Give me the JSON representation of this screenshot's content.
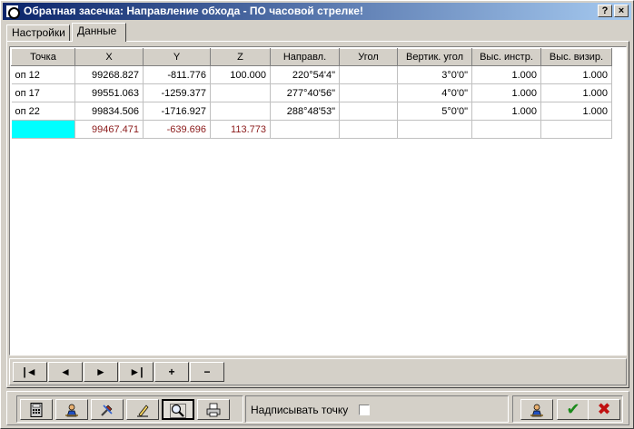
{
  "window": {
    "title": "Обратная засечка:  Направление обхода - ПО часовой стрелке!",
    "help_label": "?",
    "close_label": "×"
  },
  "tabs": [
    {
      "label": "Настройки",
      "active": false
    },
    {
      "label": "Данные",
      "active": true
    }
  ],
  "grid": {
    "columns": [
      "Точка",
      "X",
      "Y",
      "Z",
      "Направл.",
      "Угол",
      "Вертик. угол",
      "Выс. инстр.",
      "Выс. визир."
    ],
    "rows": [
      [
        "оп 12",
        "99268.827",
        "-811.776",
        "100.000",
        "220°54'4\"",
        "",
        "3°0'0\"",
        "1.000",
        "1.000"
      ],
      [
        "оп 17",
        "99551.063",
        "-1259.377",
        "",
        "277°40'56\"",
        "",
        "4°0'0\"",
        "1.000",
        "1.000"
      ],
      [
        "оп 22",
        "99834.506",
        "-1716.927",
        "",
        "288°48'53\"",
        "",
        "5°0'0\"",
        "1.000",
        "1.000"
      ]
    ],
    "result_row": [
      "",
      "99467.471",
      "-639.696",
      "113.773",
      "",
      "",
      "",
      "",
      ""
    ],
    "result_color": "#8b1a1a",
    "result_highlight": "#00ffff"
  },
  "navigator": {
    "first": "|◄",
    "prev": "◄",
    "next": "►",
    "last": "►|",
    "add": "+",
    "delete": "−"
  },
  "toolbar": {
    "icons": [
      "calculator-icon",
      "surveyor-icon",
      "tools-icon",
      "pencil-icon",
      "zoom-icon",
      "printer-icon"
    ],
    "pressed_index": 4
  },
  "label_point": {
    "text": "Надписывать точку",
    "checked": false
  },
  "actions": {
    "ok_label": "✔",
    "cancel_label": "✖"
  }
}
